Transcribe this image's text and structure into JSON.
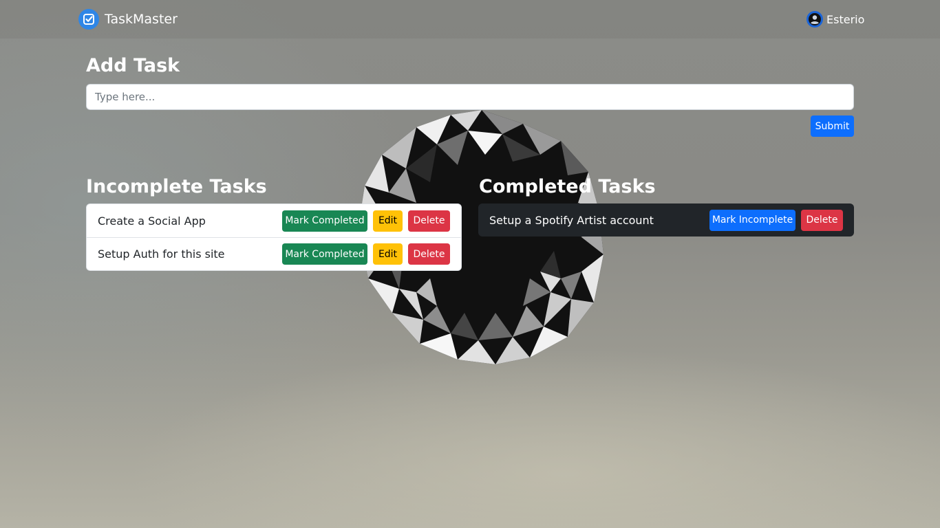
{
  "navbar": {
    "brand_name": "TaskMaster",
    "brand_icon": "checkbox-icon",
    "user_icon": "user-circle-icon",
    "user_name": "Esterio"
  },
  "add_task": {
    "title": "Add Task",
    "placeholder": "Type here...",
    "value": "",
    "submit_label": "Submit"
  },
  "incomplete": {
    "title": "Incomplete Tasks",
    "tasks": [
      {
        "text": "Create a Social App",
        "complete_label": "Mark Completed",
        "edit_label": "Edit",
        "delete_label": "Delete"
      },
      {
        "text": "Setup Auth for this site",
        "complete_label": "Mark Completed",
        "edit_label": "Edit",
        "delete_label": "Delete"
      }
    ]
  },
  "completed": {
    "title": "Completed Tasks",
    "tasks": [
      {
        "text": "Setup a Spotify Artist account",
        "incomplete_label": "Mark Incomplete",
        "delete_label": "Delete"
      }
    ]
  },
  "colors": {
    "primary": "#0d6efd",
    "success": "#198754",
    "warning": "#ffc107",
    "danger": "#dc3545",
    "dark_list": "#212529"
  }
}
